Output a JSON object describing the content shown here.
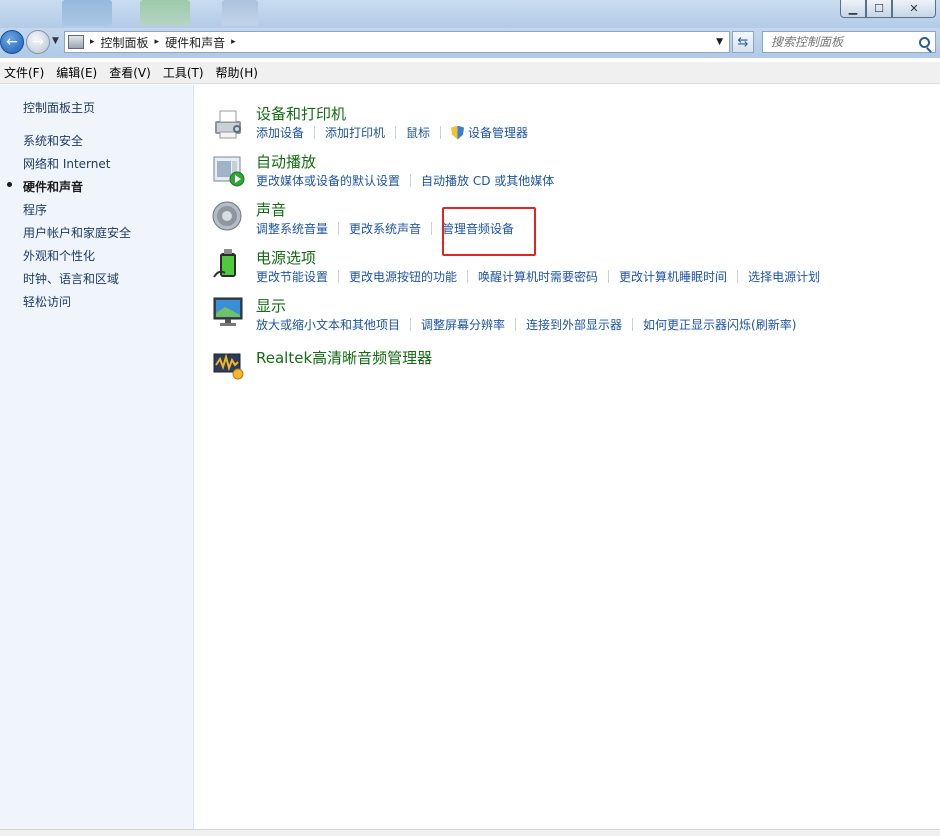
{
  "window": {
    "minimize_glyph": "▁",
    "maximize_glyph": "☐",
    "close_glyph": "✕"
  },
  "nav": {
    "back_glyph": "←",
    "forward_glyph": "→",
    "dropdown_glyph": "▼",
    "separator_glyph": "▸",
    "refresh_glyph": "⇆",
    "breadcrumb": [
      "控制面板",
      "硬件和声音"
    ],
    "search_placeholder": "搜索控制面板"
  },
  "menu": [
    "文件(F)",
    "编辑(E)",
    "查看(V)",
    "工具(T)",
    "帮助(H)"
  ],
  "sidebar": {
    "home": "控制面板主页",
    "items": [
      "系统和安全",
      "网络和 Internet",
      "硬件和声音",
      "程序",
      "用户帐户和家庭安全",
      "外观和个性化",
      "时钟、语言和区域",
      "轻松访问"
    ],
    "current_index": 2
  },
  "categories": [
    {
      "title": "设备和打印机",
      "icon": "printer-icon",
      "links": [
        "添加设备",
        "添加打印机",
        "鼠标",
        "设备管理器"
      ]
    },
    {
      "title": "自动播放",
      "icon": "autoplay-icon",
      "links": [
        "更改媒体或设备的默认设置",
        "自动播放 CD 或其他媒体"
      ]
    },
    {
      "title": "声音",
      "icon": "speaker-icon",
      "links": [
        "调整系统音量",
        "更改系统声音",
        "管理音频设备"
      ]
    },
    {
      "title": "电源选项",
      "icon": "battery-icon",
      "links": [
        "更改节能设置",
        "更改电源按钮的功能",
        "唤醒计算机时需要密码",
        "更改计算机睡眠时间",
        "选择电源计划"
      ]
    },
    {
      "title": "显示",
      "icon": "monitor-icon",
      "links": [
        "放大或缩小文本和其他项目",
        "调整屏幕分辨率",
        "连接到外部显示器",
        "如何更正显示器闪烁(刷新率)"
      ]
    },
    {
      "title": "Realtek高清晰音频管理器",
      "icon": "realtek-audio-icon",
      "links": []
    }
  ],
  "colors": {
    "link_blue": "#1e54a2",
    "title_green": "#146b14",
    "highlight_red": "#e02525"
  }
}
